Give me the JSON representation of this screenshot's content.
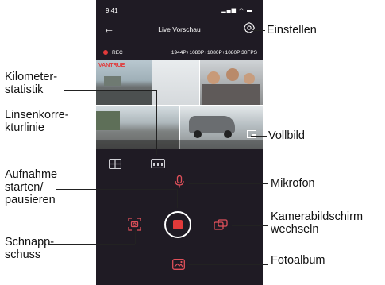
{
  "status": {
    "time": "9:41",
    "indicators": "▂▄▆ ◠ ▬"
  },
  "header": {
    "back_icon": "←",
    "title": "Live Vorschau"
  },
  "recbar": {
    "rec_label": "REC",
    "resolution": "1944P+1080P+1080P+1080P 30FPS"
  },
  "video": {
    "brand": "VANTRUE"
  },
  "callouts": {
    "settings": "Einstellen",
    "km_stats_line1": "Kilometer-",
    "km_stats_line2": "statistik",
    "lens_line1": "Linsenkorre-",
    "lens_line2": "kturlinie",
    "fullscreen": "Vollbild",
    "record_line1": "Aufnahme",
    "record_line2": "starten/",
    "record_line3": "pausieren",
    "mic": "Mikrofon",
    "switch_line1": "Kamerabildschirm",
    "switch_line2": "wechseln",
    "snapshot_line1": "Schnapp-",
    "snapshot_line2": "schuss",
    "album": "Fotoalbum"
  },
  "colors": {
    "accent": "#e0505a",
    "phone_bg": "#1f1b24",
    "record_red": "#e23a3a"
  }
}
